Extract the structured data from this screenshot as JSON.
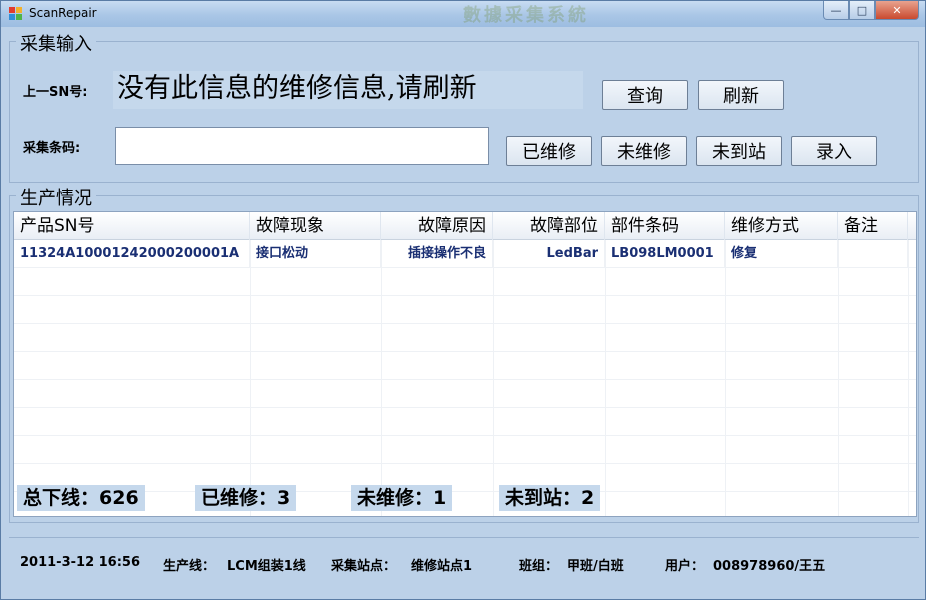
{
  "window": {
    "title": "ScanRepair",
    "ghost_title": "數據采集系統",
    "min": "—",
    "max": "□",
    "close": "✕"
  },
  "input_group": {
    "title": "采集输入",
    "last_sn_label": "上一SN号:",
    "last_sn_message": "没有此信息的维修信息,请刷新",
    "barcode_label": "采集条码:",
    "barcode_value": "",
    "query_button": "查询",
    "refresh_button": "刷新",
    "repaired_button": "已维修",
    "unrepaired_button": "未维修",
    "not_arrived_button": "未到站",
    "enter_button": "录入"
  },
  "production_group": {
    "title": "生产情况",
    "columns": [
      "产品SN号",
      "故障现象",
      "故障原因",
      "故障部位",
      "部件条码",
      "维修方式",
      "备注"
    ],
    "rows": [
      [
        "11324A10001242000200001A",
        "接口松动",
        "插接操作不良",
        "LedBar",
        "LB098LM0001",
        "修复",
        ""
      ]
    ],
    "stats": {
      "total": "总下线：626",
      "repaired": "已维修：3",
      "unrepaired": "未维修：1",
      "not_arrived": "未到站：2"
    }
  },
  "status_bar": {
    "datetime": "2011-3-12 16:56",
    "line_label": "生产线：",
    "line_value": "LCM组装1线",
    "station_label": "采集站点：",
    "station_value": "维修站点1",
    "shift_label": "班组：",
    "shift_value": "甲班/白班",
    "user_label": "用户：",
    "user_value": "008978960/王五"
  }
}
